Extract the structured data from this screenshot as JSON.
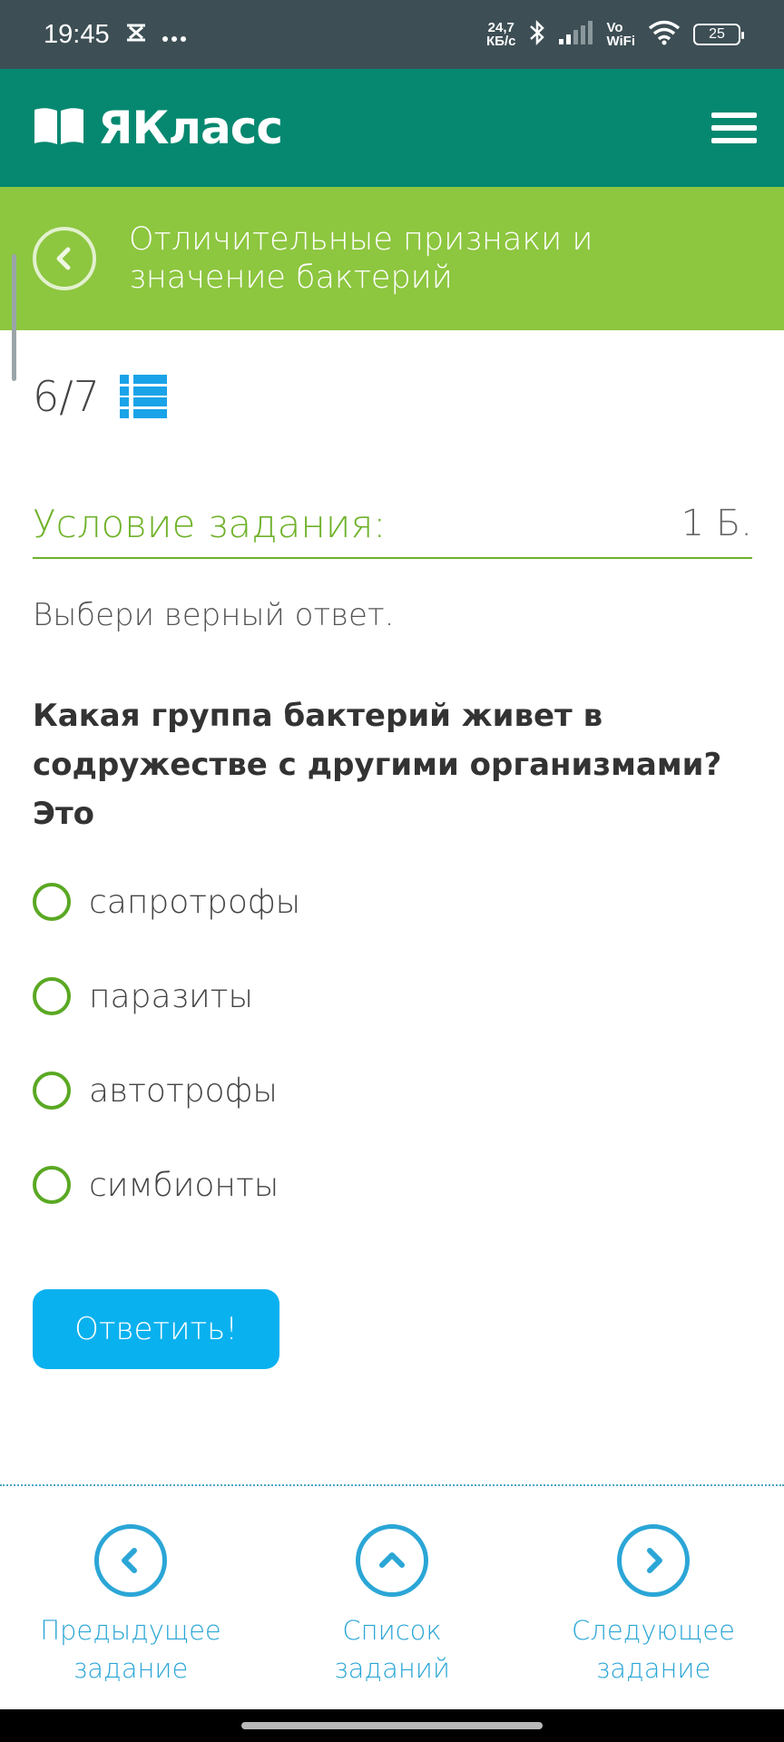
{
  "status_bar": {
    "time": "19:45",
    "icons_left": [
      "custom-x-icon",
      "more-dots-icon"
    ],
    "net_speed_value": "24,7",
    "net_speed_unit": "КБ/с",
    "vo": "Vo",
    "wifi": "WiFi",
    "battery_level": "25"
  },
  "header": {
    "logo_text": "ЯКласс",
    "menu_icon": "hamburger-menu-icon"
  },
  "topic": {
    "title": "Отличительные признаки и значение бактерий"
  },
  "progress": {
    "current": "6",
    "separator": "/",
    "total": "7"
  },
  "condition": {
    "title": "Условие задания:",
    "points": "1 Б."
  },
  "instruction": "Выбери верный ответ.",
  "question": "Какая группа бактерий живет в содружестве с другими организмами? Это",
  "options": [
    {
      "label": "сапротрофы"
    },
    {
      "label": "паразиты"
    },
    {
      "label": "автотрофы"
    },
    {
      "label": "симбионты"
    }
  ],
  "answer_button": "Ответить!",
  "bottom_nav": {
    "prev_line1": "Предыдущее",
    "prev_line2": "задание",
    "list_line1": "Список",
    "list_line2": "заданий",
    "next_line1": "Следующее",
    "next_line2": "задание"
  },
  "colors": {
    "status_bar": "#3d4f55",
    "header": "#068870",
    "topic_banner": "#8dc63f",
    "accent_green": "#6fb22a",
    "button_blue": "#0ab1ef",
    "nav_blue": "#2ba6d6"
  }
}
